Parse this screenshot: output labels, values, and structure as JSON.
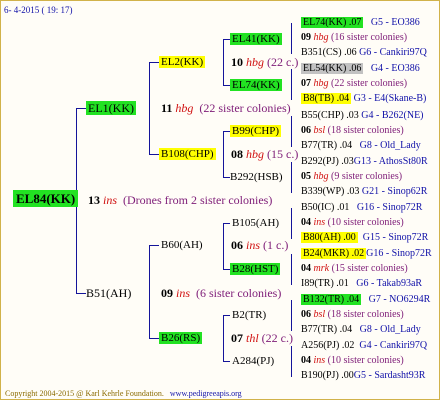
{
  "header": {
    "date": "6- 4-2015 ( 19: 17)"
  },
  "root": {
    "label": "EL84(KK)",
    "num": "13",
    "abbr": "ins",
    "note": "(Drones from 2 sister colonies)"
  },
  "gen2": [
    {
      "label": "EL1(KK)",
      "num": "11",
      "abbr": "hbg",
      "note": "(22 sister colonies)"
    },
    {
      "label": "B51(AH)",
      "num": "09",
      "abbr": "ins",
      "note": "(6 sister colonies)"
    }
  ],
  "gen3": [
    {
      "label": "EL2(KK)",
      "num": "10",
      "abbr": "hbg",
      "note": "(22 c.)"
    },
    {
      "label": "B108(CHP)",
      "num": "08",
      "abbr": "hbg",
      "note": "(15 c.)"
    },
    {
      "label": "B60(AH)",
      "num": "06",
      "abbr": "ins",
      "note": "(1 c.)"
    },
    {
      "label": "B26(RS)",
      "num": "07",
      "abbr": "thl",
      "note": "(22 c.)"
    }
  ],
  "gen4": [
    {
      "label": "EL41(KK)"
    },
    {
      "label": "EL74(KK)"
    },
    {
      "label": "B99(CHP)"
    },
    {
      "label": "B292(HSB)"
    },
    {
      "label": "B105(AH)"
    },
    {
      "label": "B28(HST)"
    },
    {
      "label": "B2(TR)"
    },
    {
      "label": "A284(PJ)"
    }
  ],
  "gen5": [
    {
      "label": "EL74(KK)",
      "year": ".07",
      "ref": "G5 - EO386"
    },
    {
      "num": "09",
      "abbr": "hbg",
      "note": "(16 sister colonies)"
    },
    {
      "label": "B351(CS)",
      "year": ".06",
      "ref": "G6 - Cankiri97Q"
    },
    {
      "label": "EL54(KK)",
      "year": ".06",
      "ref": "G4 - EO386"
    },
    {
      "num": "07",
      "abbr": "hbg",
      "note": "(22 sister colonies)"
    },
    {
      "label": "B8(TB)",
      "year": ".04",
      "ref": "G3 - E4(Skane-B)"
    },
    {
      "label": "B55(CHP)",
      "year": ".03",
      "ref": "G4 - B262(NE)"
    },
    {
      "num": "06",
      "abbr": "bsl",
      "note": "(18 sister colonies)"
    },
    {
      "label": "B77(TR)",
      "year": ".04",
      "ref": "G8 - Old_Lady"
    },
    {
      "label": "B292(PJ)",
      "year": ".03",
      "ref": "G13 - AthosSt80R"
    },
    {
      "num": "05",
      "abbr": "hbg",
      "note": "(9 sister colonies)"
    },
    {
      "label": "B339(WP)",
      "year": ".03",
      "ref": "G21 - Sinop62R"
    },
    {
      "label": "B50(IC)",
      "year": ".01",
      "ref": "G16 - Sinop72R"
    },
    {
      "num": "04",
      "abbr": "ins",
      "note": "(10 sister colonies)"
    },
    {
      "label": "B80(AH)",
      "year": ".00",
      "ref": "G15 - Sinop72R"
    },
    {
      "label": "B24(MKR)",
      "year": ".02",
      "ref": "G16 - Sinop72R"
    },
    {
      "num": "04",
      "abbr": "mrk",
      "note": "(15 sister colonies)"
    },
    {
      "label": "I89(TR)",
      "year": ".01",
      "ref": "G6 - Takab93aR"
    },
    {
      "label": "B132(TR)",
      "year": ".04",
      "ref": "G7 - NO6294R"
    },
    {
      "num": "06",
      "abbr": "bsl",
      "note": "(18 sister colonies)"
    },
    {
      "label": "B77(TR)",
      "year": ".04",
      "ref": "G8 - Old_Lady"
    },
    {
      "label": "A256(PJ)",
      "year": ".02",
      "ref": "G4 - Cankiri97Q"
    },
    {
      "num": "04",
      "abbr": "ins",
      "note": "(10 sister colonies)"
    },
    {
      "label": "B190(PJ)",
      "year": ".00",
      "ref": "G5 - Sardasht93R"
    }
  ],
  "footer": {
    "copyright": "Copyright 2004-2015 @ Karl Kehrle Foundation.",
    "url": "www.pedigreeapis.org"
  },
  "colors": {
    "green": "#22e222",
    "yellow": "#ffff00",
    "grey": "#c2c2c2",
    "line": "#14149a"
  }
}
